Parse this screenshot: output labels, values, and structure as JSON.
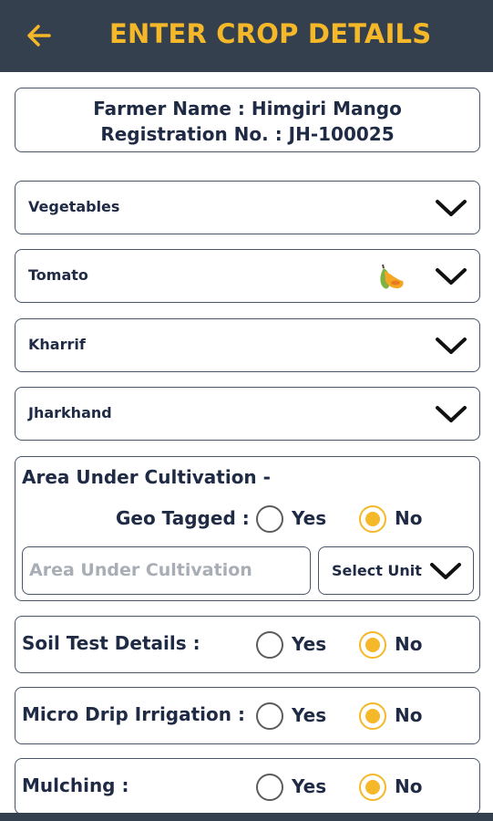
{
  "header": {
    "title": "ENTER CROP DETAILS",
    "back_icon": "arrow-left-icon",
    "bg_color": "#35404f",
    "title_color": "#f5b829"
  },
  "farmer": {
    "name_line": "Farmer Name : Himgiri Mango",
    "reg_line": "Registration No. : JH-100025"
  },
  "dropdowns": [
    {
      "value": "Vegetables"
    },
    {
      "value": "Tomato",
      "icon": "fruit-icon"
    },
    {
      "value": "Kharrif"
    },
    {
      "value": "Jharkhand"
    }
  ],
  "area": {
    "label": "Area Under Cultivation -",
    "geo_label": "Geo Tagged :",
    "yes": "Yes",
    "no": "No",
    "geo_selected": "No",
    "input_placeholder": "Area Under Cultivation",
    "unit_value": "Select Unit"
  },
  "rows": [
    {
      "label": "Soil Test Details :",
      "yes": "Yes",
      "no": "No",
      "selected": "No"
    },
    {
      "label": "Micro Drip Irrigation :",
      "yes": "Yes",
      "no": "No",
      "selected": "No"
    },
    {
      "label": "Mulching :",
      "yes": "Yes",
      "no": "No",
      "selected": "No"
    }
  ],
  "colors": {
    "accent": "#f5b829",
    "text": "#1f2a44",
    "border": "#4a5468"
  }
}
